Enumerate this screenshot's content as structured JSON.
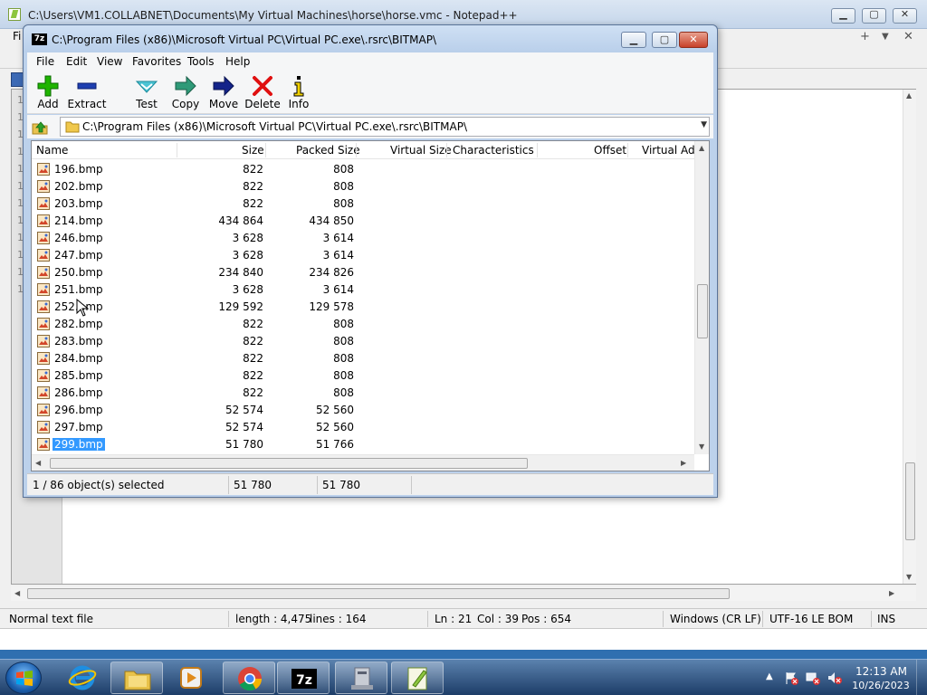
{
  "notepad": {
    "title": "C:\\Users\\VM1.COLLABNET\\Documents\\My Virtual Machines\\horse\\horse.vmc - Notepad++",
    "menu_file": "Fi",
    "plus": "+",
    "chevron": "▼",
    "close": "✕",
    "line_numbers": [
      "1",
      "1",
      "1",
      "1",
      "1",
      "1",
      "1",
      "1",
      "1",
      "1",
      "1",
      "1"
    ],
    "status": {
      "file_type": "Normal text file",
      "length": "length : 4,475",
      "lines": "lines : 164",
      "ln": "Ln : 21",
      "col": "Col : 39",
      "pos": "Pos : 654",
      "eol": "Windows (CR LF)",
      "encoding": "UTF-16 LE BOM",
      "mode": "INS"
    }
  },
  "zip": {
    "title": "C:\\Program Files (x86)\\Microsoft Virtual PC\\Virtual PC.exe\\.rsrc\\BITMAP\\",
    "icon_text": "7z",
    "menu": [
      "File",
      "Edit",
      "View",
      "Favorites",
      "Tools",
      "Help"
    ],
    "toolbar": {
      "add": "Add",
      "extract": "Extract",
      "test": "Test",
      "copy": "Copy",
      "move": "Move",
      "delete": "Delete",
      "info": "Info"
    },
    "address": "C:\\Program Files (x86)\\Microsoft Virtual PC\\Virtual PC.exe\\.rsrc\\BITMAP\\",
    "columns": [
      "Name",
      "Size",
      "Packed Size",
      "Virtual Size",
      "Characteristics",
      "Offset",
      "Virtual Add"
    ],
    "rows": [
      {
        "name": "196.bmp",
        "size": "822",
        "packed": "808"
      },
      {
        "name": "202.bmp",
        "size": "822",
        "packed": "808"
      },
      {
        "name": "203.bmp",
        "size": "822",
        "packed": "808"
      },
      {
        "name": "214.bmp",
        "size": "434 864",
        "packed": "434 850"
      },
      {
        "name": "246.bmp",
        "size": "3 628",
        "packed": "3 614"
      },
      {
        "name": "247.bmp",
        "size": "3 628",
        "packed": "3 614"
      },
      {
        "name": "250.bmp",
        "size": "234 840",
        "packed": "234 826"
      },
      {
        "name": "251.bmp",
        "size": "3 628",
        "packed": "3 614"
      },
      {
        "name": "252.bmp",
        "size": "129 592",
        "packed": "129 578"
      },
      {
        "name": "282.bmp",
        "size": "822",
        "packed": "808"
      },
      {
        "name": "283.bmp",
        "size": "822",
        "packed": "808"
      },
      {
        "name": "284.bmp",
        "size": "822",
        "packed": "808"
      },
      {
        "name": "285.bmp",
        "size": "822",
        "packed": "808"
      },
      {
        "name": "286.bmp",
        "size": "822",
        "packed": "808"
      },
      {
        "name": "296.bmp",
        "size": "52 574",
        "packed": "52 560"
      },
      {
        "name": "297.bmp",
        "size": "52 574",
        "packed": "52 560"
      },
      {
        "name": "299.bmp",
        "size": "51 780",
        "packed": "51 766"
      }
    ],
    "selected_index": 16,
    "status": {
      "selection": "1 / 86 object(s) selected",
      "size": "51 780",
      "packed": "51 780"
    }
  },
  "taskbar": {
    "clock_time": "12:13 AM",
    "clock_date": "10/26/2023",
    "apps": [
      "windows-explorer",
      "internet-explorer",
      "file-explorer",
      "media-player",
      "chrome",
      "7-zip",
      "virtual-pc",
      "notepad++"
    ]
  }
}
